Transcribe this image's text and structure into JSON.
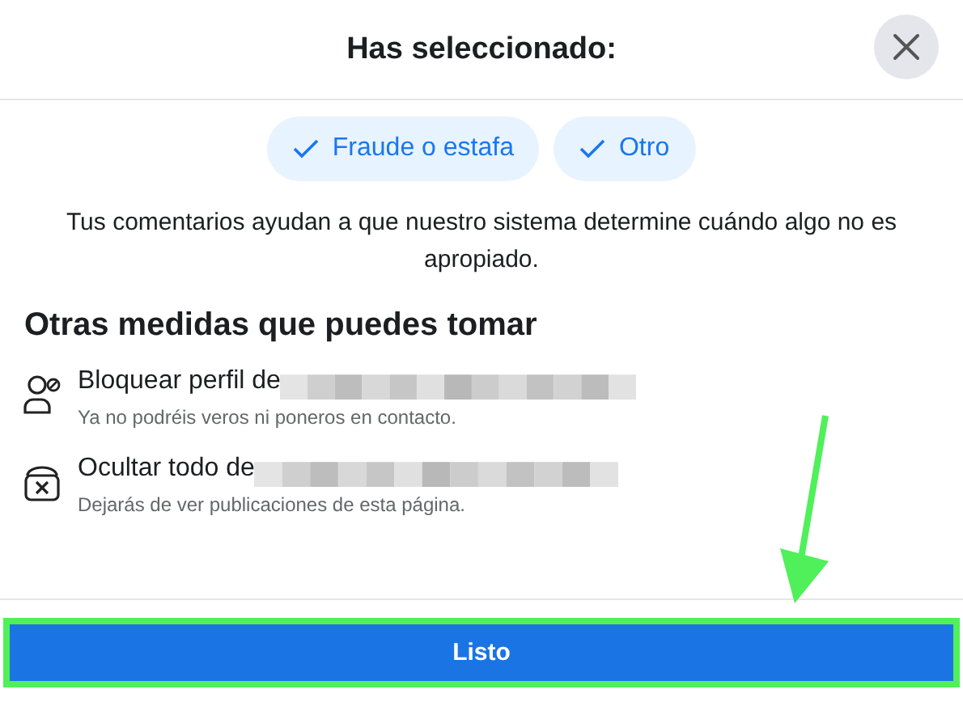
{
  "dialog": {
    "title": "Has seleccionado:"
  },
  "chips": [
    {
      "label": "Fraude o estafa",
      "selected": true
    },
    {
      "label": "Otro",
      "selected": true
    }
  ],
  "description": "Tus comentarios ayudan a que nuestro sistema determine cuándo algo no es apropiado.",
  "section_heading": "Otras medidas que puedes tomar",
  "actions": [
    {
      "kind": "block",
      "label": "Bloquear perfil de",
      "subtitle": "Ya no podréis veros ni poneros en contacto."
    },
    {
      "kind": "hide",
      "label": "Ocultar todo de",
      "subtitle": "Dejarás de ver publicaciones de esta página."
    }
  ],
  "primary_button": {
    "label": "Listo",
    "highlighted": true
  }
}
